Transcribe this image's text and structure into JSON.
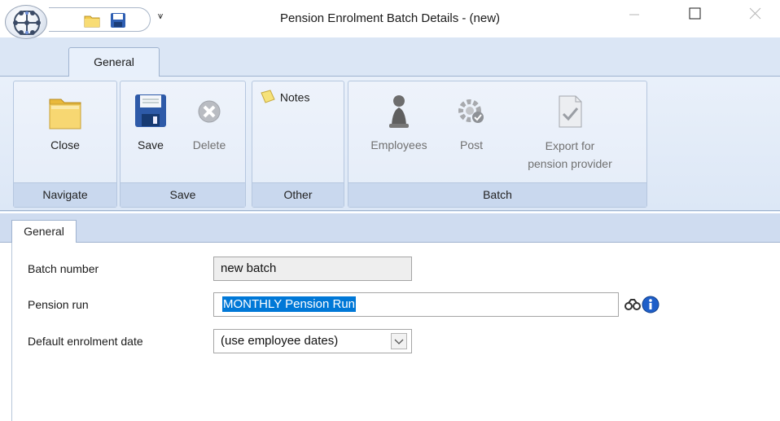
{
  "window": {
    "title": "Pension Enrolment Batch Details - (new)",
    "minimize_icon": "minimize-icon",
    "maximize_icon": "maximize-icon",
    "close_icon": "close-icon"
  },
  "quick_access": {
    "items": [
      "folder-icon",
      "save-disk-icon"
    ],
    "dropdown_glyph": "⩛"
  },
  "ribbon": {
    "tab_label": "General",
    "groups": {
      "navigate": {
        "label": "Navigate",
        "buttons": {
          "close": "Close"
        }
      },
      "save": {
        "label": "Save",
        "buttons": {
          "save": "Save",
          "delete": "Delete"
        }
      },
      "other": {
        "label": "Other",
        "buttons": {
          "notes": "Notes"
        }
      },
      "batch": {
        "label": "Batch",
        "buttons": {
          "employees": "Employees",
          "post": "Post",
          "export_line1": "Export for",
          "export_line2": "pension provider"
        }
      }
    }
  },
  "content": {
    "tab_label": "General",
    "fields": {
      "batch_number": {
        "label": "Batch number",
        "value": "new batch"
      },
      "pension_run": {
        "label": "Pension run",
        "value": "MONTHLY Pension Run"
      },
      "default_enrolment_date": {
        "label": "Default enrolment date",
        "value": "(use employee dates)"
      }
    }
  },
  "colors": {
    "ribbon_bg": "#dbe6f5",
    "selection": "#0078d7",
    "group_label_bg": "#c9d8ee"
  }
}
